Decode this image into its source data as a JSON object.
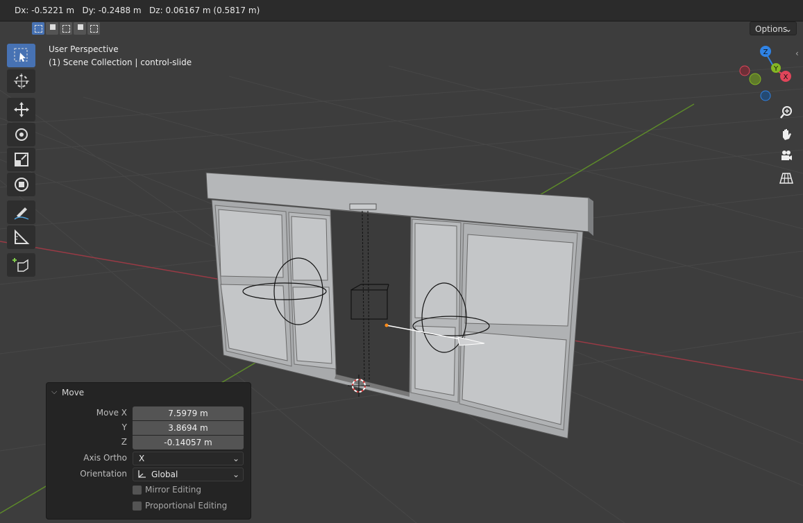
{
  "header": {
    "delta_text": "Dx: -0.5221 m   Dy: -0.2488 m   Dz: 0.06167 m (0.5817 m)",
    "options_label": "Options"
  },
  "select_modes": [
    "set",
    "extend",
    "subtract",
    "difference",
    "intersect"
  ],
  "viewport": {
    "title": "User Perspective",
    "subtitle": "(1) Scene Collection | control-slide"
  },
  "toolbar": [
    {
      "name": "select-box",
      "icon": "select-box-icon",
      "active": true
    },
    {
      "name": "cursor",
      "icon": "cursor-icon"
    },
    {
      "name": "move",
      "icon": "move-icon"
    },
    {
      "name": "rotate",
      "icon": "rotate-icon"
    },
    {
      "name": "scale",
      "icon": "scale-icon"
    },
    {
      "name": "transform",
      "icon": "transform-icon"
    },
    {
      "name": "annotate",
      "icon": "annotate-icon"
    },
    {
      "name": "measure",
      "icon": "measure-icon"
    },
    {
      "name": "add-cube",
      "icon": "add-cube-icon"
    }
  ],
  "gizmo": {
    "z": "Z",
    "y": "Y",
    "x": "X"
  },
  "nav_buttons": [
    "zoom-icon",
    "hand-icon",
    "camera-icon",
    "grid-icon"
  ],
  "colors": {
    "accent": "#4772b3",
    "x_axis": "#e0455a",
    "y_axis": "#84b623",
    "z_axis": "#2f83e6"
  },
  "operator_panel": {
    "title": "Move",
    "move_x_label": "Move X",
    "move_x": "7.5979 m",
    "y_label": "Y",
    "y": "3.8694 m",
    "z_label": "Z",
    "z": "-0.14057 m",
    "axis_ortho_label": "Axis Ortho",
    "axis_ortho": "X",
    "orientation_label": "Orientation",
    "orientation": "Global",
    "mirror_label": "Mirror Editing",
    "mirror_checked": false,
    "proportional_label": "Proportional Editing",
    "proportional_checked": false
  }
}
